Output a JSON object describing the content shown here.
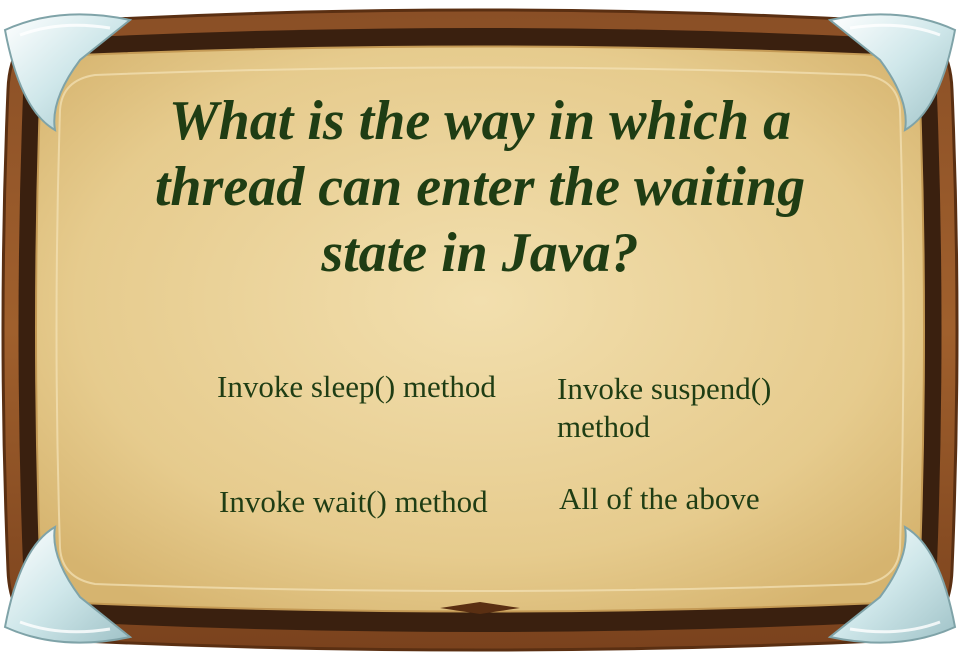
{
  "question": "What is the way in which a thread can enter the waiting state in Java?",
  "answers": [
    {
      "text": "Invoke sleep() method"
    },
    {
      "text": "Invoke suspend() method"
    },
    {
      "text": "Invoke wait() method"
    },
    {
      "text": "All of the above"
    }
  ],
  "colors": {
    "text": "#1f3d14",
    "frame_outer": "#7a4420",
    "frame_dark": "#3a200f",
    "parchment": "#e8cf93",
    "corner_metal": "#d4ecee"
  }
}
